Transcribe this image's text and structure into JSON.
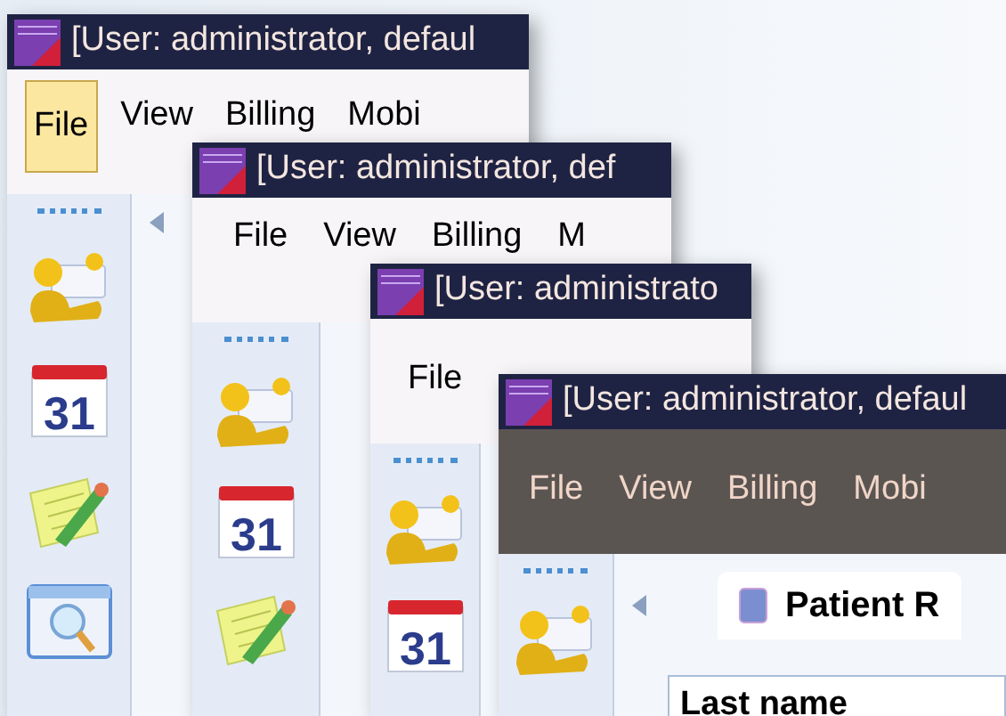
{
  "windows": [
    {
      "title": "[User: administrator, defaul",
      "menu_dark": false,
      "menu": [
        {
          "label": "File",
          "selected": true
        },
        {
          "label": "View",
          "selected": false
        },
        {
          "label": "Billing",
          "selected": false
        },
        {
          "label": "Mobi",
          "selected": false
        }
      ],
      "sidebar": [
        {
          "kind": "contacts"
        },
        {
          "kind": "calendar",
          "label": "31"
        },
        {
          "kind": "notes"
        },
        {
          "kind": "search"
        }
      ],
      "has_back": true
    },
    {
      "title": "[User: administrator, def",
      "menu_dark": false,
      "menu": [
        {
          "label": "File",
          "selected": false
        },
        {
          "label": "View",
          "selected": false
        },
        {
          "label": "Billing",
          "selected": false
        },
        {
          "label": "M",
          "selected": false
        }
      ],
      "sidebar": [
        {
          "kind": "contacts"
        },
        {
          "kind": "calendar",
          "label": "31"
        },
        {
          "kind": "notes"
        }
      ]
    },
    {
      "title": "[User: administrato",
      "menu_dark": false,
      "menu": [
        {
          "label": "File",
          "selected": false
        }
      ],
      "sidebar": [
        {
          "kind": "contacts"
        },
        {
          "kind": "calendar",
          "label": "31"
        }
      ]
    },
    {
      "title": "[User: administrator, defaul",
      "menu_dark": true,
      "menu": [
        {
          "label": "File",
          "selected": false
        },
        {
          "label": "View",
          "selected": false
        },
        {
          "label": "Billing",
          "selected": false
        },
        {
          "label": "Mobi",
          "selected": false
        }
      ],
      "sidebar": [
        {
          "kind": "contacts"
        }
      ],
      "has_back": true,
      "tab": {
        "label": "Patient R"
      },
      "field": {
        "label": "Last name"
      }
    }
  ]
}
